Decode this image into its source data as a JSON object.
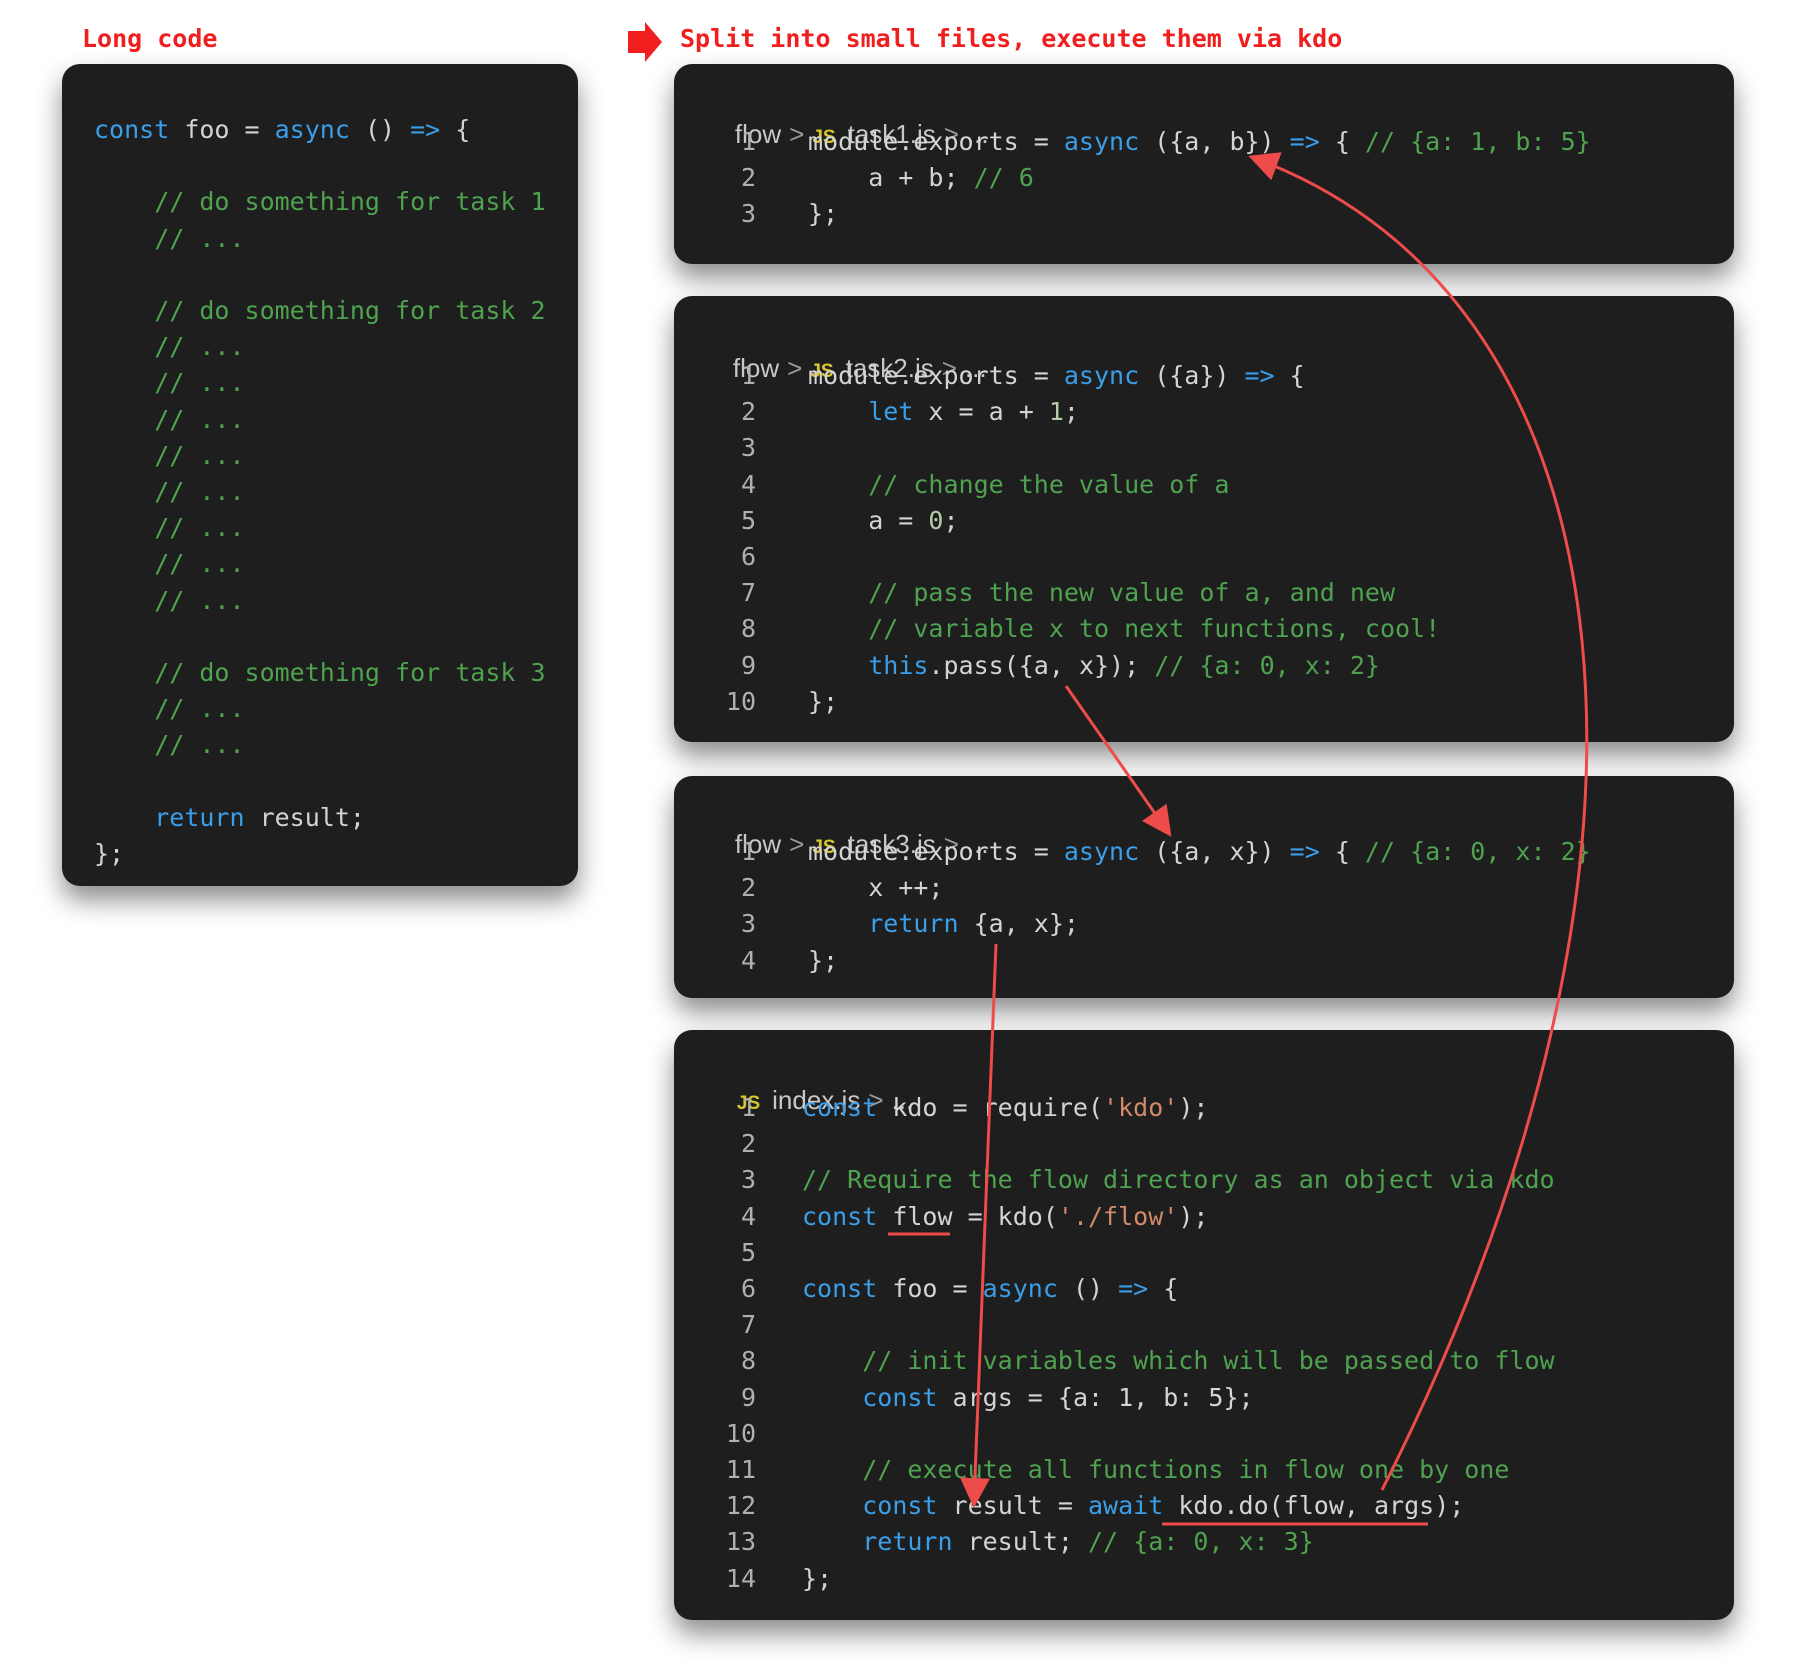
{
  "headings": {
    "left": "Long code",
    "right": "Split into small files, execute them via kdo"
  },
  "long_code": {
    "lines": [
      [
        {
          "t": "const",
          "c": "kw"
        },
        {
          "t": " foo = "
        },
        {
          "t": "async",
          "c": "kw"
        },
        {
          "t": " () "
        },
        {
          "t": "=>",
          "c": "kw"
        },
        {
          "t": " {"
        }
      ],
      [],
      [
        {
          "t": "    // do something for task 1",
          "c": "cm"
        }
      ],
      [
        {
          "t": "    // ...",
          "c": "cm"
        }
      ],
      [],
      [
        {
          "t": "    // do something for task 2",
          "c": "cm"
        }
      ],
      [
        {
          "t": "    // ...",
          "c": "cm"
        }
      ],
      [
        {
          "t": "    // ...",
          "c": "cm"
        }
      ],
      [
        {
          "t": "    // ...",
          "c": "cm"
        }
      ],
      [
        {
          "t": "    // ...",
          "c": "cm"
        }
      ],
      [
        {
          "t": "    // ...",
          "c": "cm"
        }
      ],
      [
        {
          "t": "    // ...",
          "c": "cm"
        }
      ],
      [
        {
          "t": "    // ...",
          "c": "cm"
        }
      ],
      [
        {
          "t": "    // ...",
          "c": "cm"
        }
      ],
      [],
      [
        {
          "t": "    // do something for task 3",
          "c": "cm"
        }
      ],
      [
        {
          "t": "    // ...",
          "c": "cm"
        }
      ],
      [
        {
          "t": "    // ...",
          "c": "cm"
        }
      ],
      [],
      [
        {
          "t": "    "
        },
        {
          "t": "return",
          "c": "kw"
        },
        {
          "t": " result;"
        }
      ],
      [
        {
          "t": "};"
        }
      ]
    ]
  },
  "files": [
    {
      "breadcrumb": {
        "folder": "flow",
        "icon": "JS",
        "file": "task1.js",
        "ellipsis": "..."
      },
      "lines": [
        [
          {
            "t": "module.exports = "
          },
          {
            "t": "async",
            "c": "kw"
          },
          {
            "t": " ({a, b}) "
          },
          {
            "t": "=>",
            "c": "kw"
          },
          {
            "t": " { "
          },
          {
            "t": "// {a: 1, b: 5}",
            "c": "cm"
          }
        ],
        [
          {
            "t": "    a + b; "
          },
          {
            "t": "// 6",
            "c": "cm"
          }
        ],
        [
          {
            "t": "};"
          }
        ]
      ]
    },
    {
      "breadcrumb": {
        "folder": "flow",
        "icon": "JS",
        "file": "task2.js",
        "ellipsis": "..."
      },
      "lines": [
        [
          {
            "t": "module.exports = "
          },
          {
            "t": "async",
            "c": "kw"
          },
          {
            "t": " ({a}) "
          },
          {
            "t": "=>",
            "c": "kw"
          },
          {
            "t": " {"
          }
        ],
        [
          {
            "t": "    "
          },
          {
            "t": "let",
            "c": "kw"
          },
          {
            "t": " x = a + "
          },
          {
            "t": "1",
            "c": "num"
          },
          {
            "t": ";"
          }
        ],
        [],
        [
          {
            "t": "    // change the value of a",
            "c": "cm"
          }
        ],
        [
          {
            "t": "    a = "
          },
          {
            "t": "0",
            "c": "num"
          },
          {
            "t": ";"
          }
        ],
        [],
        [
          {
            "t": "    // pass the new value of a, and new",
            "c": "cm"
          }
        ],
        [
          {
            "t": "    // variable x to next functions, cool!",
            "c": "cm"
          }
        ],
        [
          {
            "t": "    "
          },
          {
            "t": "this",
            "c": "kw"
          },
          {
            "t": ".pass({a, x}); "
          },
          {
            "t": "// {a: 0, x: 2}",
            "c": "cm"
          }
        ],
        [
          {
            "t": "};"
          }
        ]
      ]
    },
    {
      "breadcrumb": {
        "folder": "flow",
        "icon": "JS",
        "file": "task3.js",
        "ellipsis": "..."
      },
      "lines": [
        [
          {
            "t": "module.exports = "
          },
          {
            "t": "async",
            "c": "kw"
          },
          {
            "t": " ({a, x}) "
          },
          {
            "t": "=>",
            "c": "kw"
          },
          {
            "t": " { "
          },
          {
            "t": "// {a: 0, x: 2}",
            "c": "cm"
          }
        ],
        [
          {
            "t": "    x ++;"
          }
        ],
        [
          {
            "t": "    "
          },
          {
            "t": "return",
            "c": "kw"
          },
          {
            "t": " {a, x};"
          }
        ],
        [
          {
            "t": "};"
          }
        ]
      ]
    },
    {
      "breadcrumb": {
        "folder": "",
        "icon": "JS",
        "file": "index.js",
        "ellipsis": "..."
      },
      "lines": [
        [
          {
            "t": "const",
            "c": "kw"
          },
          {
            "t": " kdo = require("
          },
          {
            "t": "'kdo'",
            "c": "str"
          },
          {
            "t": ");"
          }
        ],
        [],
        [
          {
            "t": "// Require the flow directory as an object via kdo",
            "c": "cm"
          }
        ],
        [
          {
            "t": "const",
            "c": "kw"
          },
          {
            "t": " flow = kdo("
          },
          {
            "t": "'./flow'",
            "c": "str"
          },
          {
            "t": ");"
          }
        ],
        [],
        [
          {
            "t": "const",
            "c": "kw"
          },
          {
            "t": " foo = "
          },
          {
            "t": "async",
            "c": "kw"
          },
          {
            "t": " () "
          },
          {
            "t": "=>",
            "c": "kw"
          },
          {
            "t": " {"
          }
        ],
        [],
        [
          {
            "t": "    // init variables which will be passed to flow",
            "c": "cm"
          }
        ],
        [
          {
            "t": "    "
          },
          {
            "t": "const",
            "c": "kw"
          },
          {
            "t": " args = {a: 1, b: 5};"
          }
        ],
        [],
        [
          {
            "t": "    // execute all functions in flow one by one",
            "c": "cm"
          }
        ],
        [
          {
            "t": "    "
          },
          {
            "t": "const",
            "c": "kw"
          },
          {
            "t": " result = "
          },
          {
            "t": "await",
            "c": "kw"
          },
          {
            "t": " kdo.do(flow, args);"
          }
        ],
        [
          {
            "t": "    "
          },
          {
            "t": "return",
            "c": "kw"
          },
          {
            "t": " result; "
          },
          {
            "t": "// {a: 0, x: 3}",
            "c": "cm"
          }
        ],
        [
          {
            "t": "};"
          }
        ]
      ]
    }
  ],
  "colors": {
    "panel_bg": "#1e1e1e",
    "keyword": "#3a9ee8",
    "comment": "#4fa24f",
    "string": "#d08a6a",
    "annotation": "#ee4b4b",
    "heading": "#f01e1e"
  },
  "icons": [
    "right-arrow-icon",
    "chevron-right-icon",
    "js-file-icon"
  ]
}
